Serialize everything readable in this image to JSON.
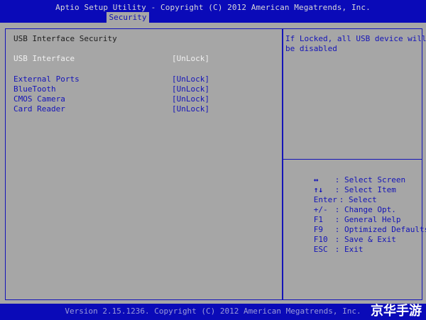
{
  "header": {
    "title": "Aptio Setup Utility - Copyright (C) 2012 American Megatrends, Inc.",
    "active_tab": "Security"
  },
  "left": {
    "section_title": "USB Interface Security",
    "items": [
      {
        "label": "USB Interface",
        "value": "[UnLock]",
        "selected": true
      },
      {
        "label": "External Ports",
        "value": "[UnLock]"
      },
      {
        "label": "BlueTooth",
        "value": "[UnLock]"
      },
      {
        "label": "CMOS Camera",
        "value": "[UnLock]"
      },
      {
        "label": "Card Reader",
        "value": "[UnLock]"
      }
    ]
  },
  "help": {
    "line1": "If Locked, all USB device will",
    "line2": "be disabled"
  },
  "keys": [
    {
      "key": "↔",
      "desc": ": Select Screen"
    },
    {
      "key": "↑↓",
      "desc": ": Select Item"
    },
    {
      "key": "Enter",
      "desc": ": Select"
    },
    {
      "key": "+/-",
      "desc": ": Change Opt."
    },
    {
      "key": "F1",
      "desc": ": General Help"
    },
    {
      "key": "F9",
      "desc": ": Optimized Defaults"
    },
    {
      "key": "F10",
      "desc": ": Save & Exit"
    },
    {
      "key": "ESC",
      "desc": ": Exit"
    }
  ],
  "footer": {
    "version": "Version 2.15.1236. Copyright (C) 2012 American Megatrends, Inc.",
    "watermark": "京华手游"
  }
}
